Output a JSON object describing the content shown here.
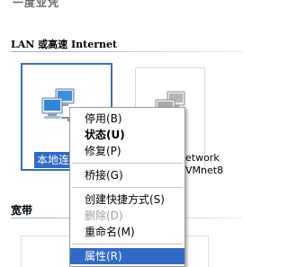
{
  "top_cut_text": "一度业凭",
  "sections": {
    "lan_header": "LAN 或高速 Internet",
    "broadband_header": "宽带"
  },
  "connections": {
    "selected_label": "本地连",
    "other_label_line1": "etwork",
    "other_label_line2": "VMnet8"
  },
  "context_menu": {
    "items": [
      {
        "label": "停用(B)"
      },
      {
        "label": "状态(U)"
      },
      {
        "label": "修复(P)"
      },
      {
        "label": "桥接(G)"
      },
      {
        "label": "创建快捷方式(S)"
      },
      {
        "label": "删除(D)"
      },
      {
        "label": "重命名(M)"
      },
      {
        "label": "属性(R)"
      }
    ]
  },
  "colors": {
    "selection": "#316ac5",
    "tile_border": "#3d6fa8"
  }
}
